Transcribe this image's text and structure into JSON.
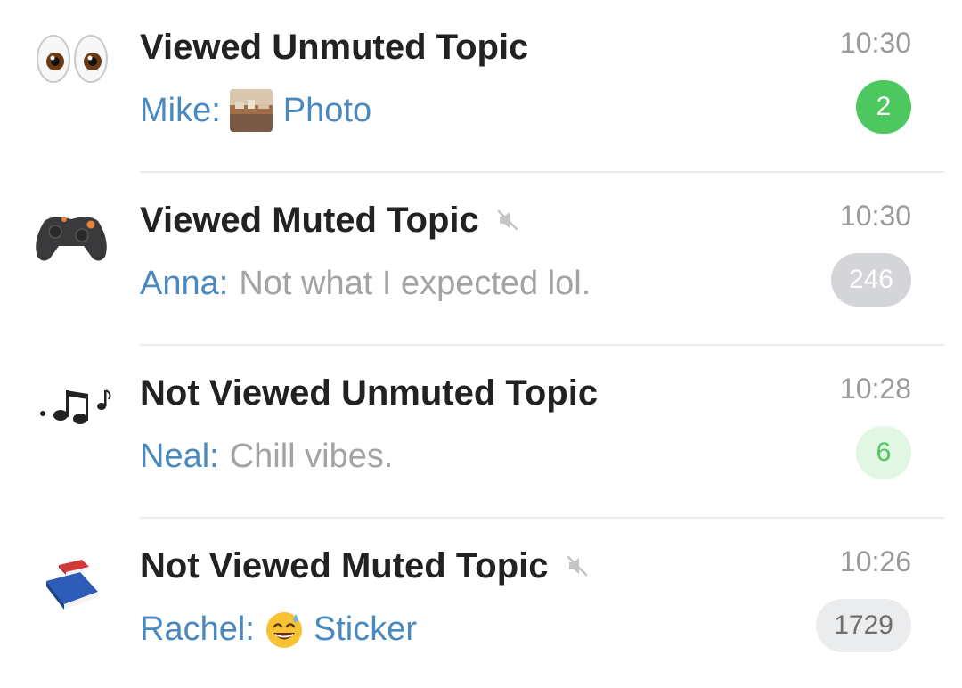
{
  "topics": [
    {
      "title": "Viewed Unmuted Topic",
      "icon": "eyes-icon",
      "muted": false,
      "time": "10:30",
      "sender": "Mike:",
      "message": "Photo",
      "message_type": "photo",
      "badge": "2",
      "badge_style": "green"
    },
    {
      "title": "Viewed Muted Topic",
      "icon": "game-controller-icon",
      "muted": true,
      "time": "10:30",
      "sender": "Anna:",
      "message": "Not what I expected lol.",
      "message_type": "text",
      "badge": "246",
      "badge_style": "gray"
    },
    {
      "title": "Not Viewed Unmuted Topic",
      "icon": "music-notes-icon",
      "muted": false,
      "time": "10:28",
      "sender": "Neal:",
      "message": "Chill vibes.",
      "message_type": "text",
      "badge": "6",
      "badge_style": "light-green"
    },
    {
      "title": "Not Viewed Muted Topic",
      "icon": "books-icon",
      "muted": true,
      "time": "10:26",
      "sender": "Rachel:",
      "message": "Sticker",
      "message_type": "sticker",
      "badge": "1729",
      "badge_style": "light-gray"
    }
  ],
  "colors": {
    "sender": "#4a88c0",
    "unread_green": "#4cc85e",
    "muted_gray": "#d3d5d8",
    "time": "#9a9a9a"
  }
}
